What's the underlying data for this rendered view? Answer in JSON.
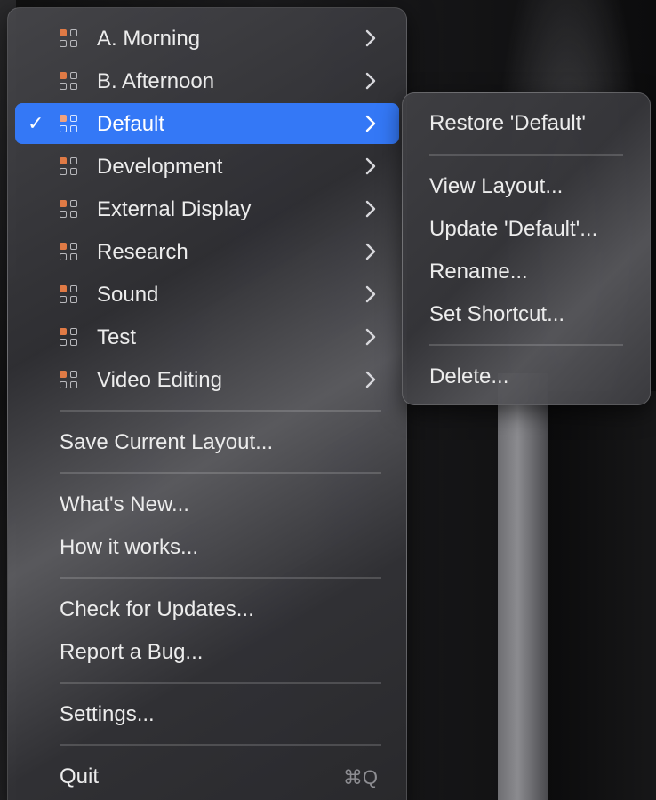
{
  "layouts": [
    {
      "label": "A. Morning"
    },
    {
      "label": "B. Afternoon"
    },
    {
      "label": "Default",
      "selected": true
    },
    {
      "label": "Development"
    },
    {
      "label": "External Display"
    },
    {
      "label": "Research"
    },
    {
      "label": "Sound"
    },
    {
      "label": "Test"
    },
    {
      "label": "Video Editing"
    }
  ],
  "checkmark": "✓",
  "menu": {
    "save_current_layout": "Save Current Layout...",
    "whats_new": "What's New...",
    "how_it_works": "How it works...",
    "check_for_updates": "Check for Updates...",
    "report_a_bug": "Report a Bug...",
    "settings": "Settings...",
    "quit": "Quit",
    "quit_shortcut": "⌘Q"
  },
  "submenu": {
    "restore": "Restore 'Default'",
    "view_layout": "View Layout...",
    "update": "Update 'Default'...",
    "rename": "Rename...",
    "set_shortcut": "Set Shortcut...",
    "delete": "Delete..."
  },
  "colors": {
    "selection": "#3478f6",
    "icon_accent": "#e07a45",
    "text": "#ececec",
    "shortcut_text": "#8d8d92"
  }
}
